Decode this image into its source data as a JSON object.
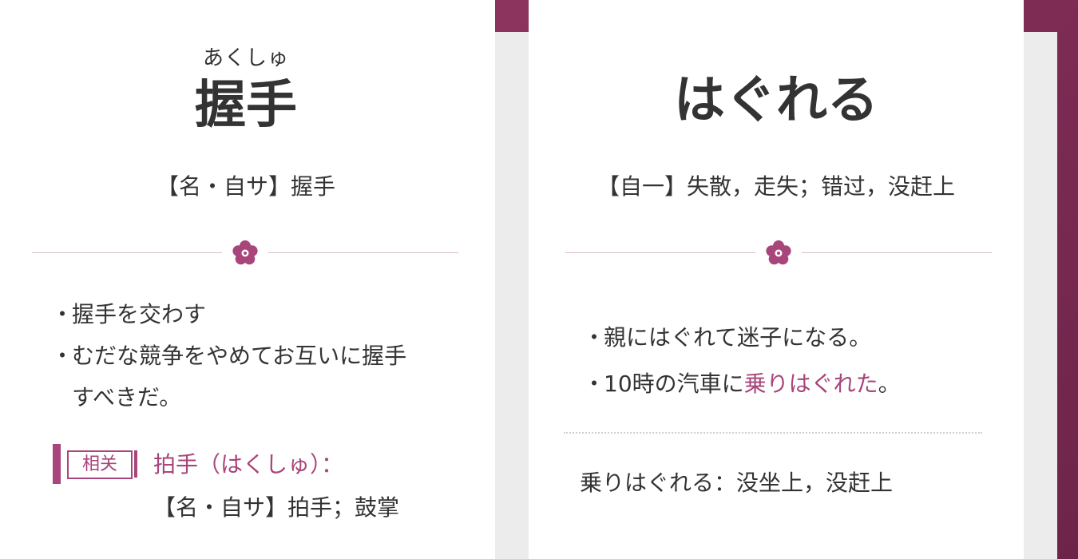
{
  "colors": {
    "accent": "#a8457a",
    "background": "#7a2d55",
    "divider": "#d9b9c9"
  },
  "left_card": {
    "ruby": "あくしゅ",
    "headword": "握手",
    "definition": "【名・自サ】握手",
    "divider_icon": "sakura-flower-icon",
    "examples": [
      {
        "bullet": "・",
        "text": "握手を交わす"
      },
      {
        "bullet": "・",
        "text": "むだな競争をやめてお互いに握手",
        "text_cont": "すべきだ。"
      }
    ],
    "related": {
      "tag": "相关",
      "title": "拍手（はくしゅ）：",
      "definition": "【名・自サ】拍手；鼓掌"
    }
  },
  "right_card": {
    "headword": "はぐれる",
    "definition": "【自一】失散，走失；错过，没赶上",
    "divider_icon": "sakura-flower-icon",
    "examples": [
      {
        "bullet": "・",
        "text": "親にはぐれて迷子になる。"
      },
      {
        "bullet": "・",
        "pre": "10時の汽車に",
        "highlight": "乗りはぐれた",
        "post": "。"
      }
    ],
    "phrase": "乗りはぐれる：没坐上，没赶上"
  }
}
